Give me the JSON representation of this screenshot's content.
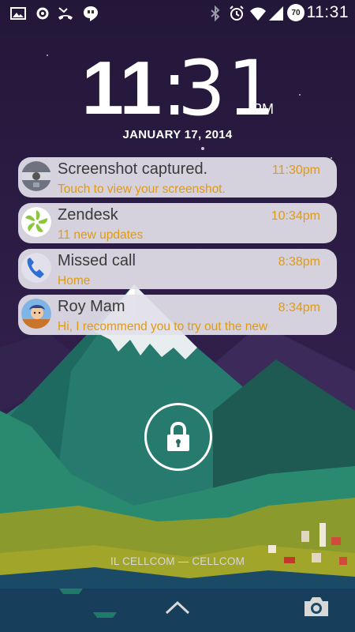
{
  "status_bar": {
    "left_icons": [
      "image-icon",
      "settings-cog-icon",
      "missed-call-icon",
      "hangouts-icon"
    ],
    "right_icons": [
      "bluetooth-icon",
      "alarm-icon",
      "wifi-icon",
      "signal-icon"
    ],
    "battery": "70",
    "time": "11:31"
  },
  "clock": {
    "hours": "11",
    "colon": ":",
    "minutes": "31",
    "ampm": "PM"
  },
  "date": "JANUARY 17, 2014",
  "notifications": [
    {
      "icon": "screenshot-icon",
      "title": "Screenshot captured.",
      "time": "11:30pm",
      "text": "Touch to view your screenshot."
    },
    {
      "icon": "zendesk-icon",
      "title": "Zendesk",
      "time": "10:34pm",
      "text": "11 new updates"
    },
    {
      "icon": "phone-icon",
      "title": "Missed call",
      "time": "8:38pm",
      "text": "Home"
    },
    {
      "icon": "contact-avatar",
      "title": "Roy Mam",
      "time": "8:34pm",
      "text": "Hi, I recommend you to try out the new"
    }
  ],
  "carrier": "IL CELLCOM — CELLCOM",
  "colors": {
    "accent_time": "#e09a14",
    "card_bg": "#e2e0ea",
    "sky": "#2b1d44"
  }
}
